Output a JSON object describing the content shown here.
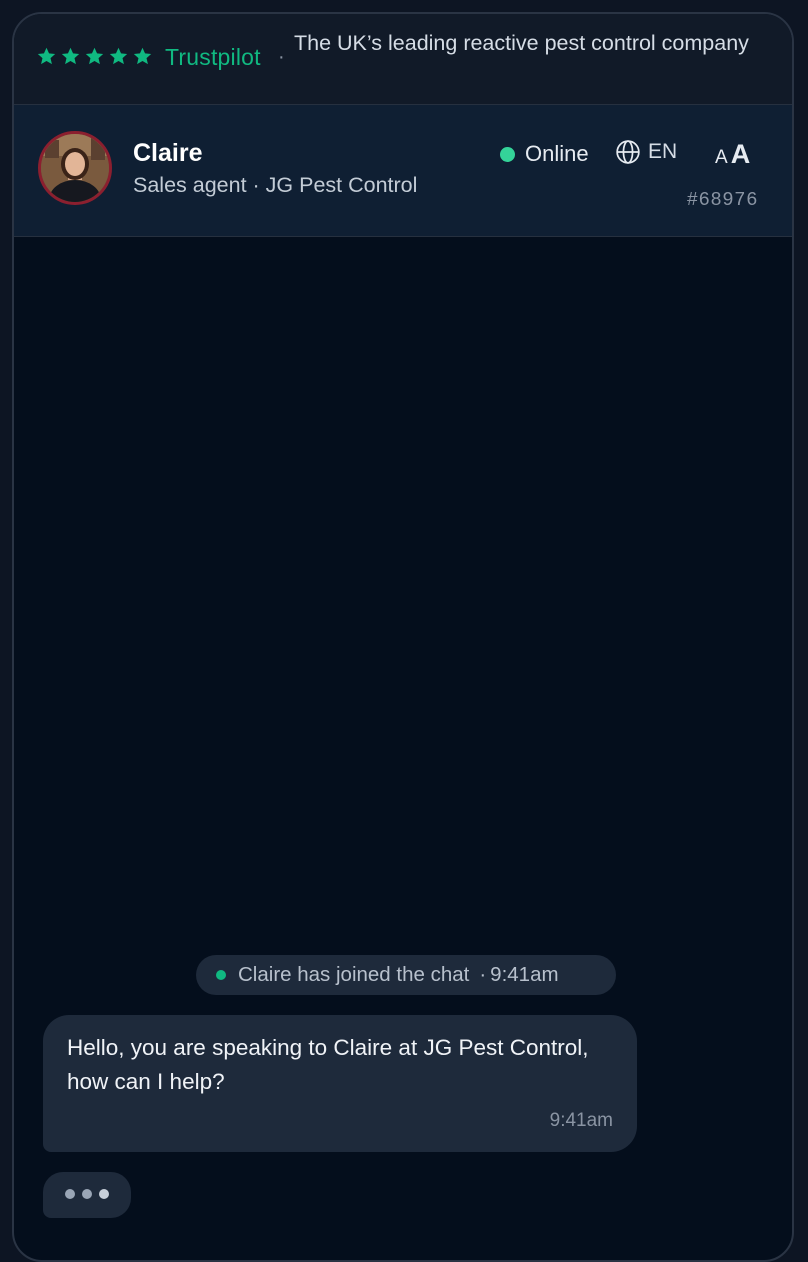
{
  "banner": {
    "rating_stars": 5,
    "trust_label": "Trustpilot",
    "separator": "·",
    "tagline": "The UK’s leading reactive pest control company"
  },
  "agent": {
    "name": "Claire",
    "role": "Sales agent · JG Pest Control",
    "status_label": "Online",
    "language": "EN",
    "font_size_small": "A",
    "font_size_large": "A",
    "ticket_id": "#68976"
  },
  "chat": {
    "system_message": {
      "text": "Claire has joined the chat",
      "separator": "·",
      "time": "9:41am"
    },
    "messages": [
      {
        "sender": "agent",
        "text": "Hello, you are speaking to Claire at JG Pest Control, how can I help?",
        "time": "9:41am"
      }
    ],
    "typing_indicator": true
  },
  "colors": {
    "accent_green": "#10b981",
    "online_green": "#34d399",
    "background": "#040e1c",
    "bubble": "#1e2a3b",
    "avatar_ring": "#8b1f2f"
  },
  "icons": [
    "star-icon",
    "globe-icon"
  ]
}
